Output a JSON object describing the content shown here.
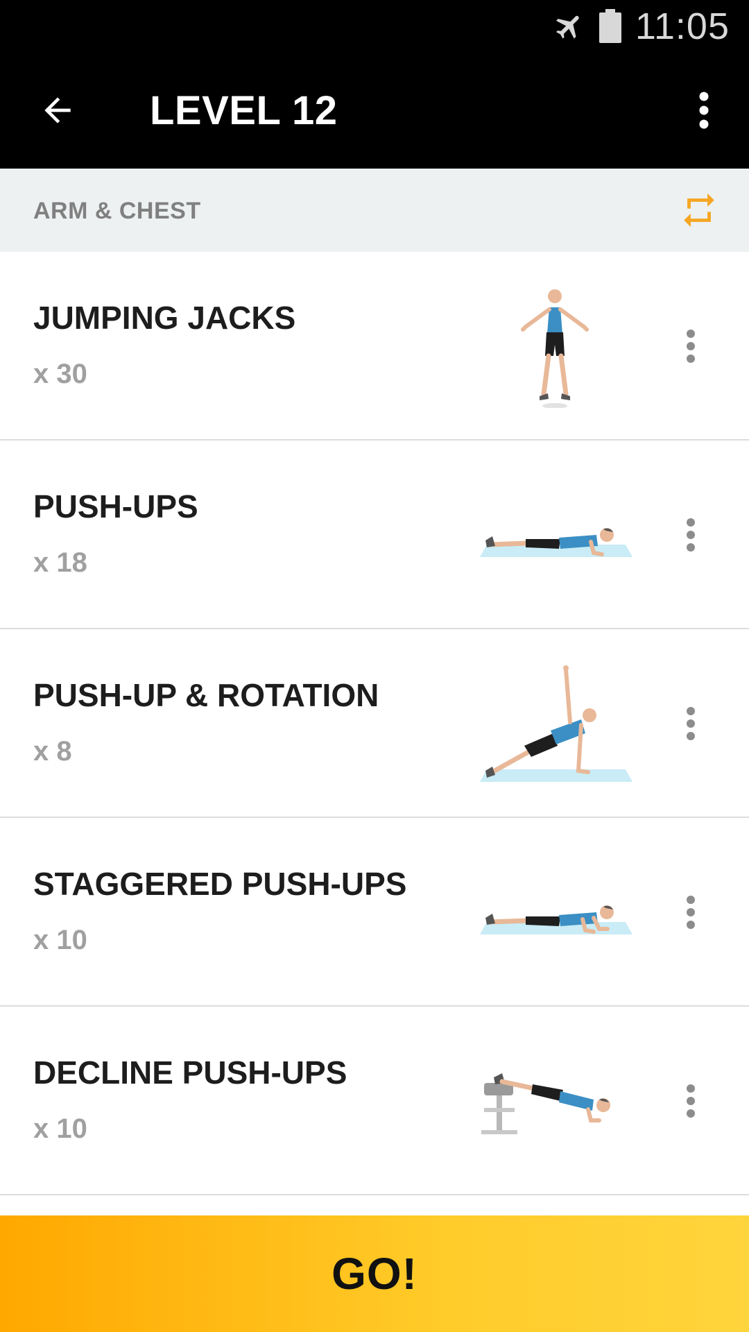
{
  "status_bar": {
    "time": "11:05",
    "icons": [
      "airplane-mode-icon",
      "battery-icon"
    ]
  },
  "toolbar": {
    "title": "LEVEL 12",
    "back_icon": "arrow-back-icon",
    "menu_icon": "more-vert-icon"
  },
  "category": {
    "label": "ARM & CHEST",
    "action_icon": "swap-icon",
    "accent_color": "#f5a623"
  },
  "exercises": [
    {
      "name": "JUMPING JACKS",
      "reps": "x 30",
      "illustration": "jumping-jacks-figure"
    },
    {
      "name": "PUSH-UPS",
      "reps": "x 18",
      "illustration": "push-up-figure"
    },
    {
      "name": "PUSH-UP & ROTATION",
      "reps": "x 8",
      "illustration": "push-up-rotation-figure"
    },
    {
      "name": "STAGGERED PUSH-UPS",
      "reps": "x 10",
      "illustration": "staggered-push-up-figure"
    },
    {
      "name": "DECLINE PUSH-UPS",
      "reps": "x 10",
      "illustration": "decline-push-up-figure"
    }
  ],
  "go_button": {
    "label": "GO!",
    "gradient_start": "#ffa800",
    "gradient_end": "#ffd43c"
  }
}
